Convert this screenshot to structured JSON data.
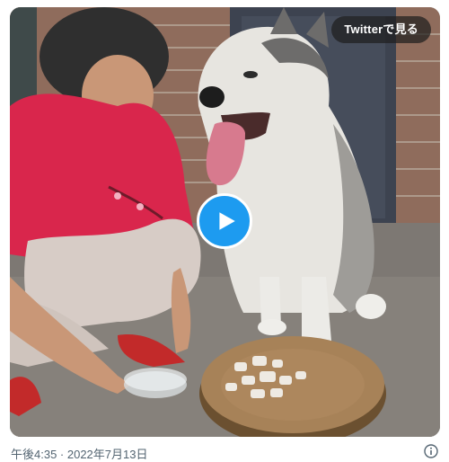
{
  "video": {
    "watch_label": "Twitterで見る",
    "play_icon": "play-icon"
  },
  "footer": {
    "timestamp": "午後4:35 · 2022年7月13日",
    "info_icon": "info-icon"
  },
  "colors": {
    "play_button": "#1d9bf0",
    "pill_background": "#1e1e1e",
    "meta_text": "#536471"
  }
}
